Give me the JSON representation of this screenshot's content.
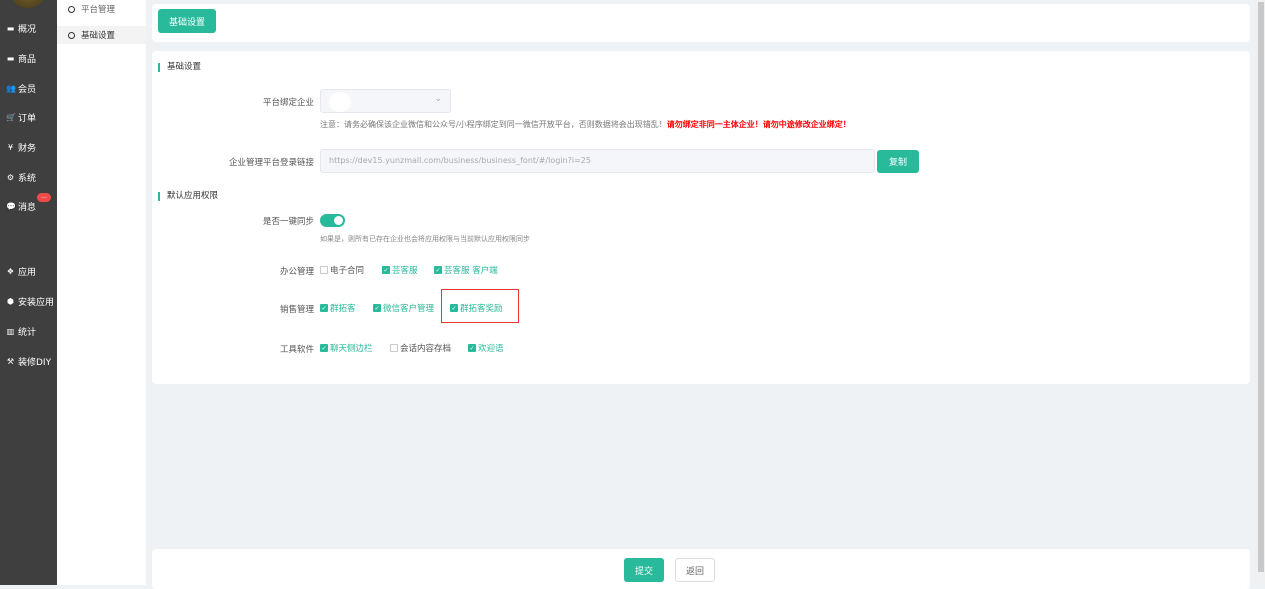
{
  "sidebar": {
    "items": [
      {
        "label": "概况",
        "icon": "overview-icon",
        "glyph": "▬"
      },
      {
        "label": "商品",
        "icon": "goods-icon",
        "glyph": "▬"
      },
      {
        "label": "会员",
        "icon": "members-icon",
        "glyph": "👥"
      },
      {
        "label": "订单",
        "icon": "cart-icon",
        "glyph": "🛒"
      },
      {
        "label": "财务",
        "icon": "yen-icon",
        "glyph": "¥"
      },
      {
        "label": "系统",
        "icon": "gears-icon",
        "glyph": "⚙"
      },
      {
        "label": "消息",
        "icon": "chat-icon",
        "glyph": "💬"
      },
      {
        "label": "应用",
        "icon": "apps-icon",
        "glyph": "❖"
      },
      {
        "label": "安装应用",
        "icon": "install-icon",
        "glyph": "⬢"
      },
      {
        "label": "统计",
        "icon": "stats-icon",
        "glyph": "▥"
      },
      {
        "label": "装修DIY",
        "icon": "hammer-icon",
        "glyph": "⚒"
      }
    ],
    "badge": "..."
  },
  "subnav": {
    "items": [
      {
        "label": "平台管理"
      },
      {
        "label": "基础设置"
      }
    ]
  },
  "header": {
    "tab": "基础设置"
  },
  "basic": {
    "title": "基础设置",
    "bind_label": "平台绑定企业",
    "bind_value": "",
    "notice": "注意：请务必确保该企业微信和公众号/小程序绑定到同一微信开放平台，否则数据将会出现错乱！",
    "warning": "请勿绑定非同一主体企业！请勿中途修改企业绑定！",
    "link_label": "企业管理平台登录链接",
    "link_value": "https://dev15.yunzmall.com/business/business_font/#/login?i=25",
    "copy": "复制"
  },
  "perm": {
    "title": "默认应用权限",
    "sync_label": "是否一键同步",
    "sync_on": true,
    "sync_hint": "如果是，则所有已存在企业也会将应用权限与当前默认应用权限同步",
    "groups": [
      {
        "label": "办公管理",
        "items": [
          {
            "label": "电子合同",
            "checked": false
          },
          {
            "label": "芸客服",
            "checked": true
          },
          {
            "label": "芸客服 客户端",
            "checked": true
          }
        ]
      },
      {
        "label": "销售管理",
        "items": [
          {
            "label": "群拓客",
            "checked": true
          },
          {
            "label": "微信客户管理",
            "checked": true
          },
          {
            "label": "群拓客奖励",
            "checked": true
          }
        ]
      },
      {
        "label": "工具软件",
        "items": [
          {
            "label": "聊天侧边栏",
            "checked": true
          },
          {
            "label": "会话内容存档",
            "checked": false
          },
          {
            "label": "欢迎语",
            "checked": true
          }
        ]
      }
    ]
  },
  "footer": {
    "submit": "提交",
    "back": "返回"
  },
  "colors": {
    "accent": "#29ba9c",
    "warning": "#ff0000",
    "highlight_box": "#e53935"
  }
}
